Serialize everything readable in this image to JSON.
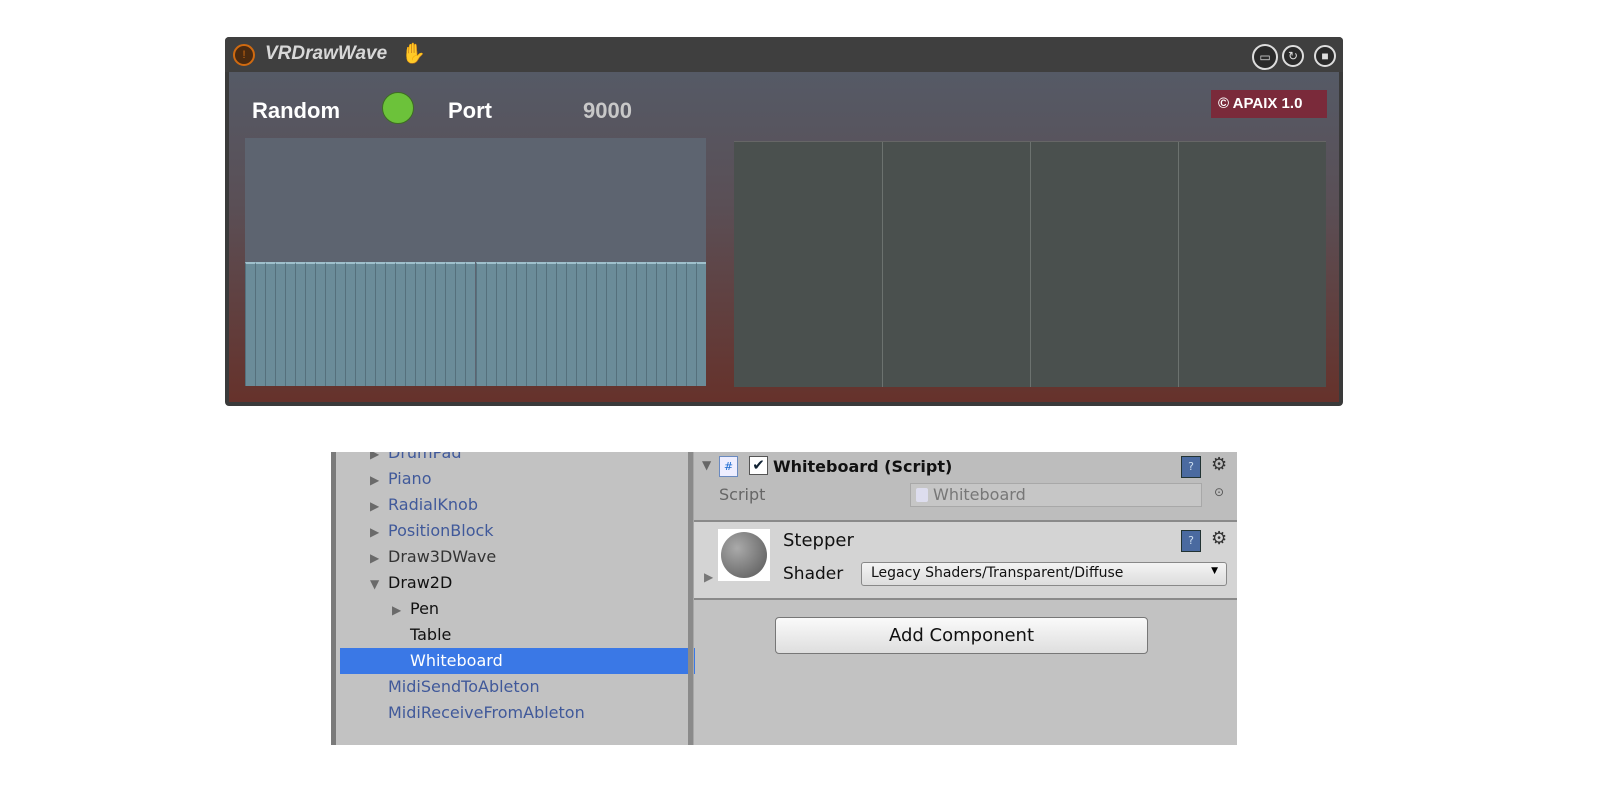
{
  "max_window": {
    "title": "VRDrawWave",
    "icons": [
      "power-icon",
      "hand-icon",
      "presentation-icon",
      "refresh-icon",
      "save-icon"
    ],
    "random_label": "Random",
    "random_toggle_color": "#6cc23a",
    "port_label": "Port",
    "port_value": "9000",
    "badge": "© APAIX 1.0",
    "multislider": {
      "count": 46,
      "values_fraction": 0.5,
      "bar_color": "#6b8c99"
    },
    "grid_columns": 4
  },
  "unity": {
    "hierarchy": [
      {
        "label": "DrumPad",
        "arrow": "▶",
        "style": "blue",
        "indent": 0
      },
      {
        "label": "Piano",
        "arrow": "▶",
        "style": "blue",
        "indent": 0
      },
      {
        "label": "RadialKnob",
        "arrow": "▶",
        "style": "blue",
        "indent": 0
      },
      {
        "label": "PositionBlock",
        "arrow": "▶",
        "style": "blue",
        "indent": 0
      },
      {
        "label": "Draw3DWave",
        "arrow": "▶",
        "style": "dark",
        "indent": 0
      },
      {
        "label": "Draw2D",
        "arrow": "▼",
        "style": "blk",
        "indent": 0
      },
      {
        "label": "Pen",
        "arrow": "▶",
        "style": "blk",
        "indent": 1
      },
      {
        "label": "Table",
        "arrow": "",
        "style": "blk",
        "indent": 1
      },
      {
        "label": "Whiteboard",
        "arrow": "",
        "style": "selected",
        "indent": 1
      },
      {
        "label": "MidiSendToAbleton",
        "arrow": "",
        "style": "blue",
        "indent": 0
      },
      {
        "label": "MidiReceiveFromAbleton",
        "arrow": "",
        "style": "blue",
        "indent": 0
      }
    ],
    "inspector": {
      "component_title": "Whiteboard (Script)",
      "script_label": "Script",
      "script_value": "Whiteboard",
      "material_name": "Stepper",
      "shader_label": "Shader",
      "shader_value": "Legacy Shaders/Transparent/Diffuse",
      "add_component": "Add Component"
    }
  }
}
